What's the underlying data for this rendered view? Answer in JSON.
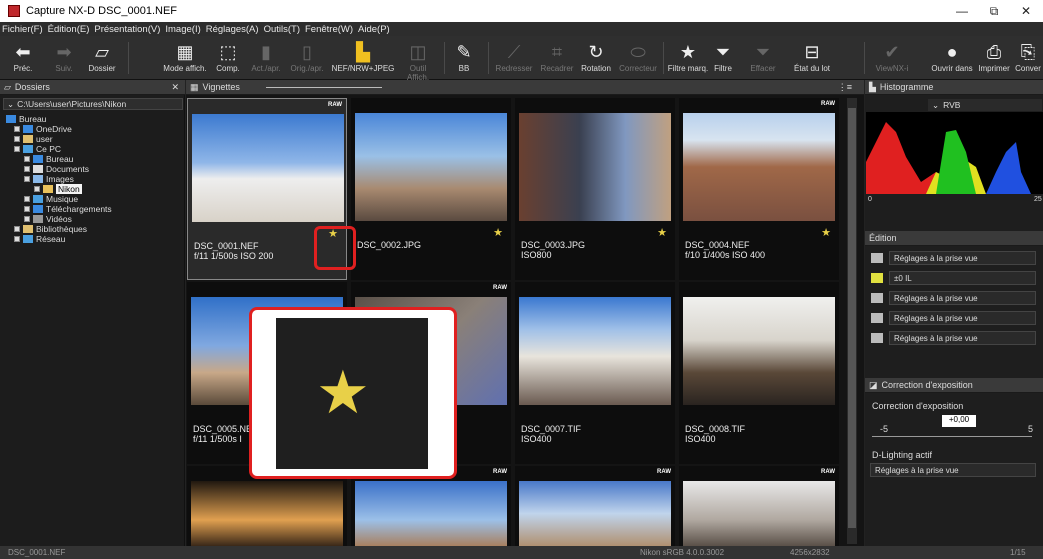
{
  "window": {
    "title": "Capture NX-D    DSC_0001.NEF",
    "minimize": "—",
    "restore": "⧉",
    "close": "✕"
  },
  "menu": [
    "Fichier(F)",
    "Édition(E)",
    "Présentation(V)",
    "Image(I)",
    "Réglages(A)",
    "Outils(T)",
    "Fenêtre(W)",
    "Aide(P)"
  ],
  "toolbar": {
    "prev": "Préc.",
    "next": "Suiv.",
    "folder": "Dossier",
    "view_mode": "Mode affich.",
    "comp": "Comp.",
    "act_apr": "Act./apr.",
    "orig_apr": "Orig./apr.",
    "nef_jpeg": "NEF/NRW+JPEG",
    "outil_affich": "Outil Affich.",
    "bb": "BB",
    "redresser": "Redresser",
    "recadrer": "Recadrer",
    "rotation": "Rotation",
    "correcteur": "Correcteur",
    "filtre_marq": "Filtre marq.",
    "filtre": "Filtre",
    "effacer": "Effacer",
    "etat_du_lot": "État du lot",
    "viewnx": "ViewNX-i",
    "ouvrir_dans": "Ouvrir dans",
    "imprimer": "Imprimer",
    "conver": "Conver"
  },
  "left": {
    "header": "Dossiers",
    "path": "C:\\Users\\user\\Pictures\\Nikon",
    "tree": [
      "Bureau",
      "OneDrive",
      "user",
      "Ce PC",
      "Bureau",
      "Documents",
      "Images",
      "Nikon",
      "Musique",
      "Téléchargements",
      "Vidéos",
      "Bibliothèques",
      "Réseau"
    ]
  },
  "center": {
    "header": "Vignettes",
    "thumbs": [
      {
        "name": "DSC_0001.NEF",
        "info": "f/11 1/500s ISO 200",
        "raw": "RAW",
        "star": "★"
      },
      {
        "name": "DSC_0002.JPG",
        "info": "",
        "raw": "",
        "star": "★"
      },
      {
        "name": "DSC_0003.JPG",
        "info": "ISO800",
        "raw": "",
        "star": "★"
      },
      {
        "name": "DSC_0004.NEF",
        "info": "f/10 1/400s ISO 400",
        "raw": "RAW",
        "star": "★"
      },
      {
        "name": "DSC_0005.NE",
        "info": "f/11 1/500s I",
        "raw": "",
        "star": ""
      },
      {
        "name": "",
        "info": "",
        "raw": "RAW",
        "star": ""
      },
      {
        "name": "DSC_0007.TIF",
        "info": "ISO400",
        "raw": "",
        "star": ""
      },
      {
        "name": "DSC_0008.TIF",
        "info": "ISO400",
        "raw": "",
        "star": ""
      },
      {
        "name": "",
        "info": "",
        "raw": "",
        "star": ""
      },
      {
        "name": "",
        "info": "",
        "raw": "RAW",
        "star": ""
      },
      {
        "name": "",
        "info": "",
        "raw": "RAW",
        "star": ""
      },
      {
        "name": "",
        "info": "",
        "raw": "RAW",
        "star": ""
      }
    ]
  },
  "right": {
    "histogram_header": "Histogramme",
    "channel": "RVB",
    "hist_max": "25",
    "hist_min": "0",
    "edition_header": "Édition",
    "rows": [
      "Réglages à la prise vue",
      "±0 IL",
      "Réglages à la prise vue",
      "Réglages à la prise vue",
      "Réglages à la prise vue"
    ],
    "exposure_header": "Correction d'exposition",
    "exposure_label": "Correction d'exposition",
    "exposure_value": "+0,00",
    "exposure_min": "-5",
    "exposure_max": "5",
    "dlighting_label": "D-Lighting actif",
    "dlighting_value": "Réglages à la prise vue"
  },
  "status": {
    "file": "DSC_0001.NEF",
    "profile": "Nikon sRGB 4.0.0.3002",
    "size": "4256x2832",
    "page": "1/15"
  }
}
